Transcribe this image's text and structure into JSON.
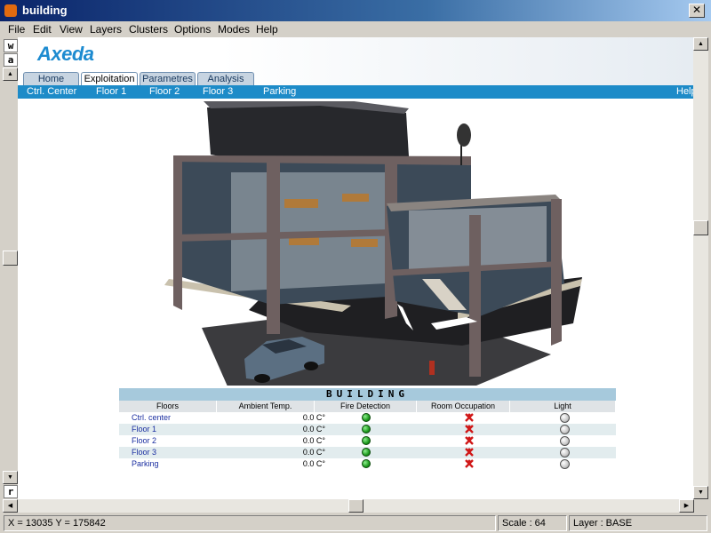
{
  "window": {
    "title": "building"
  },
  "menu": [
    "File",
    "Edit",
    "View",
    "Layers",
    "Clusters",
    "Options",
    "Modes",
    "Help"
  ],
  "left_toolbar": {
    "buttons": [
      "w",
      "a",
      "r"
    ]
  },
  "app": {
    "logo": "Axeda",
    "tabs": [
      "Home",
      "Exploitation",
      "Parametres",
      "Analysis"
    ],
    "active_tab": "Exploitation",
    "subnav": [
      "Ctrl. Center",
      "Floor 1",
      "Floor 2",
      "Floor 3",
      "Parking"
    ],
    "help": "Help"
  },
  "table": {
    "title": "BUILDING",
    "headers": [
      "Floors",
      "Ambient Temp.",
      "Fire Detection",
      "Room Occupation",
      "Light"
    ],
    "rows": [
      {
        "floor": "Ctrl. center",
        "temp": "0.0 C°",
        "fire": "green",
        "occupation": "unoccupied",
        "light": "off"
      },
      {
        "floor": "Floor 1",
        "temp": "0.0 C°",
        "fire": "green",
        "occupation": "unoccupied",
        "light": "off"
      },
      {
        "floor": "Floor 2",
        "temp": "0.0 C°",
        "fire": "green",
        "occupation": "unoccupied",
        "light": "off"
      },
      {
        "floor": "Floor 3",
        "temp": "0.0 C°",
        "fire": "green",
        "occupation": "unoccupied",
        "light": "off"
      },
      {
        "floor": "Parking",
        "temp": "0.0 C°",
        "fire": "green",
        "occupation": "unoccupied",
        "light": "off"
      }
    ]
  },
  "status": {
    "coords": "X = 13035  Y = 175842",
    "scale": "Scale :  64",
    "layer": "Layer :  BASE"
  },
  "colors": {
    "accent": "#1d8bc8",
    "title_bar": "#0a246a",
    "table_title": "#a6c9dc",
    "fire_ok": "#1d9a1d",
    "occupation_icon": "#d01818"
  }
}
